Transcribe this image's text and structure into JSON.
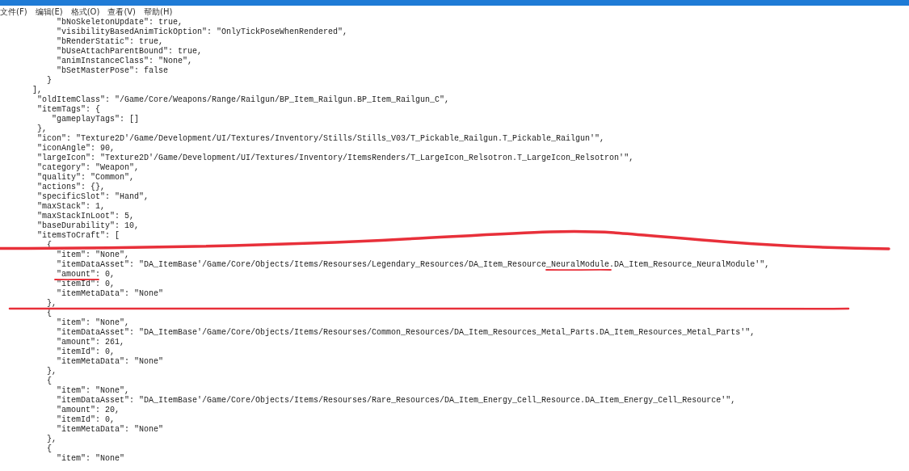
{
  "menu": [
    {
      "label": "文件(F)"
    },
    {
      "label": "编辑(E)"
    },
    {
      "label": "格式(O)"
    },
    {
      "label": "查看(V)"
    },
    {
      "label": "帮助(H)"
    }
  ],
  "lines": [
    "           \"bNoSkeletonUpdate\": true,",
    "           \"visibilityBasedAnimTickOption\": \"OnlyTickPoseWhenRendered\",",
    "           \"bRenderStatic\": true,",
    "           \"bUseAttachParentBound\": true,",
    "           \"animInstanceClass\": \"None\",",
    "           \"bSetMasterPose\": false",
    "         }",
    "      ],",
    "       \"oldItemClass\": \"/Game/Core/Weapons/Range/Railgun/BP_Item_Railgun.BP_Item_Railgun_C\",",
    "       \"itemTags\": {",
    "          \"gameplayTags\": []",
    "       },",
    "       \"icon\": \"Texture2D'/Game/Development/UI/Textures/Inventory/Stills/Stills_V03/T_Pickable_Railgun.T_Pickable_Railgun'\",",
    "       \"iconAngle\": 90,",
    "       \"largeIcon\": \"Texture2D'/Game/Development/UI/Textures/Inventory/ItemsRenders/T_LargeIcon_Relsotron.T_LargeIcon_Relsotron'\",",
    "       \"category\": \"Weapon\",",
    "       \"quality\": \"Common\",",
    "       \"actions\": {},",
    "       \"specificSlot\": \"Hand\",",
    "       \"maxStack\": 1,",
    "       \"maxStackInLoot\": 5,",
    "       \"baseDurability\": 10,",
    "       \"itemsToCraft\": [",
    "         {",
    "           \"item\": \"None\",",
    "           \"itemDataAsset\": \"DA_ItemBase'/Game/Core/Objects/Items/Resourses/Legendary_Resources/DA_Item_Resource_NeuralModule.DA_Item_Resource_NeuralModule'\",",
    "           \"amount\": 0,",
    "           \"itemId\": 0,",
    "           \"itemMetaData\": \"None\"",
    "         },",
    "         {",
    "           \"item\": \"None\",",
    "           \"itemDataAsset\": \"DA_ItemBase'/Game/Core/Objects/Items/Resourses/Common_Resources/DA_Item_Resources_Metal_Parts.DA_Item_Resources_Metal_Parts'\",",
    "           \"amount\": 261,",
    "           \"itemId\": 0,",
    "           \"itemMetaData\": \"None\"",
    "         },",
    "         {",
    "           \"item\": \"None\",",
    "           \"itemDataAsset\": \"DA_ItemBase'/Game/Core/Objects/Items/Resourses/Rare_Resources/DA_Item_Energy_Cell_Resource.DA_Item_Energy_Cell_Resource'\",",
    "           \"amount\": 20,",
    "           \"itemId\": 0,",
    "           \"itemMetaData\": \"None\"",
    "         },",
    "         {",
    "           \"item\": \"None\""
  ]
}
